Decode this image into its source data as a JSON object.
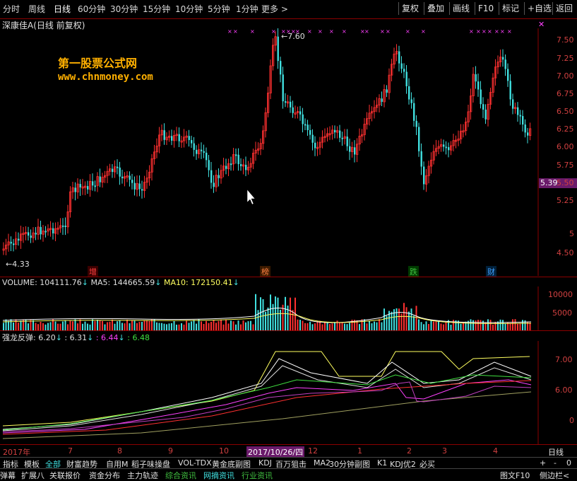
{
  "toolbar": {
    "periods": [
      "分时",
      "周线",
      "日线",
      "60分钟",
      "30分钟",
      "15分钟",
      "10分钟",
      "5分钟",
      "1分钟",
      "更多 >"
    ],
    "active_period": "日线",
    "buttons": [
      "复权",
      "叠加",
      "画线",
      "F10",
      "标记",
      "+自选",
      "返回"
    ],
    "close_glyph": "✕"
  },
  "stock": {
    "title": "深康佳A(日线 前复权)",
    "watermark_name": "第一股票公式网",
    "watermark_url": "www.chnmoney.com",
    "high_label": "7.60",
    "low_label": "4.33",
    "current_price": "5.39",
    "event_marks": [
      {
        "text": "增",
        "color": "#ff4040"
      },
      {
        "text": "榜",
        "color": "#ff8040"
      },
      {
        "text": "跌",
        "color": "#40c040"
      },
      {
        "text": "财",
        "color": "#40a0ff"
      }
    ],
    "price_axis": [
      "7.50",
      "7.25",
      "7.00",
      "6.75",
      "6.50",
      "6.25",
      "6.00",
      "5.75",
      "5.50",
      "5.25",
      "5",
      "4.50"
    ],
    "colors": {
      "up": "#ff3030",
      "down": "#40e0e0",
      "grid": "#8b0000"
    }
  },
  "volume": {
    "label": "VOLUME:",
    "value": "104111.76",
    "ma5_label": "MA5:",
    "ma5": "144665.59",
    "ma10_label": "MA10:",
    "ma10": "172150.41",
    "axis": [
      "10000",
      "5000"
    ]
  },
  "indicator": {
    "name": "强龙反弹",
    "v1": ": 6.20",
    "v2": ": 6.31",
    "v3": ": 6.44",
    "v4": ": 6.48",
    "axis": [
      "7.00",
      "6.00",
      "0"
    ]
  },
  "date_axis": {
    "labels": [
      "2017年",
      "7",
      "8",
      "9",
      "10",
      "2017/10/26/四",
      "12",
      "1",
      "2",
      "3",
      "4"
    ],
    "period_label": "日线"
  },
  "bottom_tabs_1": {
    "items": [
      "指标",
      "模板",
      "全部",
      "财富趋势",
      "自用M",
      "稻子味操盘",
      "VOL-TDX",
      "黄金底副图",
      "KDJ",
      "百万狙击",
      "MA2",
      "30分钟副图",
      "K1",
      "KDJ优2",
      "必买"
    ],
    "controls": [
      "+",
      "-",
      "0"
    ]
  },
  "bottom_tabs_2": {
    "items": [
      "弹幕",
      "扩展八",
      "关联报价",
      "资金分布",
      "主力轨迹",
      "综合资讯",
      "网摘资讯",
      "行业资讯"
    ],
    "right_items": [
      "图文F10",
      "侧边栏<"
    ]
  }
}
